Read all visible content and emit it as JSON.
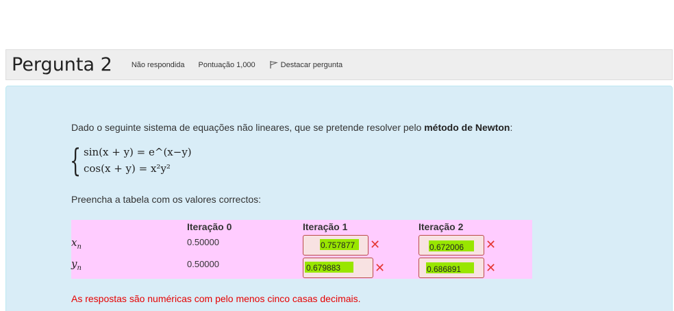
{
  "question": {
    "title": "Pergunta 2",
    "status": "Não respondida",
    "score": "Pontuação 1,000",
    "flag_label": "Destacar pergunta"
  },
  "body": {
    "intro_prefix": "Dado o seguinte sistema de equações não lineares, que se pretende resolver pelo ",
    "intro_bold": "método de Newton",
    "intro_suffix": ":",
    "equation_1": "sin(x + y) = e^(x−y)",
    "equation_2": "cos(x + y) = x²y²",
    "fill_note": "Preencha a tabela com os valores correctos:",
    "warning": "As respostas são numéricas com pelo menos cinco casas decimais."
  },
  "table": {
    "headers": [
      "Iteração 0",
      "Iteração 1",
      "Iteração 2"
    ],
    "rows": [
      {
        "label": "x",
        "sub": "n",
        "iter0": "0.50000",
        "iter1": "0.757877",
        "iter2": "0.672006"
      },
      {
        "label": "y",
        "sub": "n",
        "iter0": "0.50000",
        "iter1": "0.679883",
        "iter2": "0.686891"
      }
    ]
  },
  "icons": {
    "flag": "flag-icon",
    "incorrect": "cross-icon"
  },
  "colors": {
    "info_bg": "#d9edf7",
    "table_bg": "#ffccff",
    "incorrect": "#e53935",
    "warning_text": "#e60000",
    "highlight": "#99e600"
  }
}
